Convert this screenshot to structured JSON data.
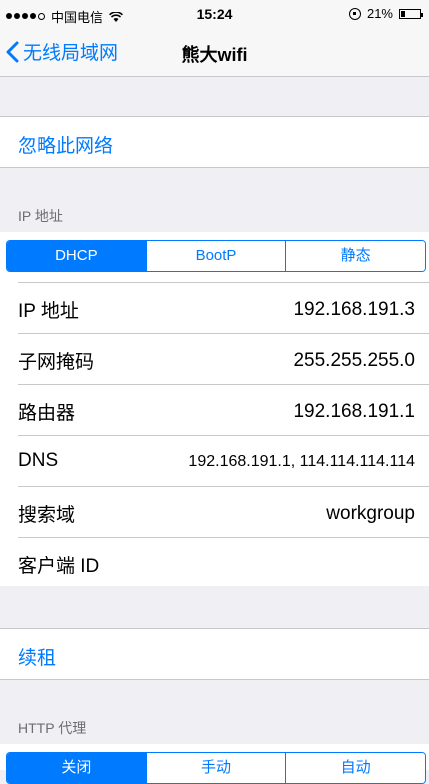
{
  "status_bar": {
    "carrier": "中国电信",
    "time": "15:24",
    "battery": "21%"
  },
  "nav": {
    "back_label": "无线局域网",
    "title": "熊大wifi"
  },
  "forget_network": "忽略此网络",
  "ip_section": {
    "header": "IP 地址",
    "segments": [
      "DHCP",
      "BootP",
      "静态"
    ],
    "selected": "DHCP",
    "rows": [
      {
        "label": "IP 地址",
        "value": "192.168.191.3"
      },
      {
        "label": "子网掩码",
        "value": "255.255.255.0"
      },
      {
        "label": "路由器",
        "value": "192.168.191.1"
      },
      {
        "label": "DNS",
        "value": "192.168.191.1, 114.114.114.114"
      },
      {
        "label": "搜索域",
        "value": "workgroup"
      },
      {
        "label": "客户端 ID",
        "value": ""
      }
    ]
  },
  "renew_lease": "续租",
  "http_proxy": {
    "header": "HTTP 代理",
    "segments": [
      "关闭",
      "手动",
      "自动"
    ],
    "selected": "关闭"
  }
}
